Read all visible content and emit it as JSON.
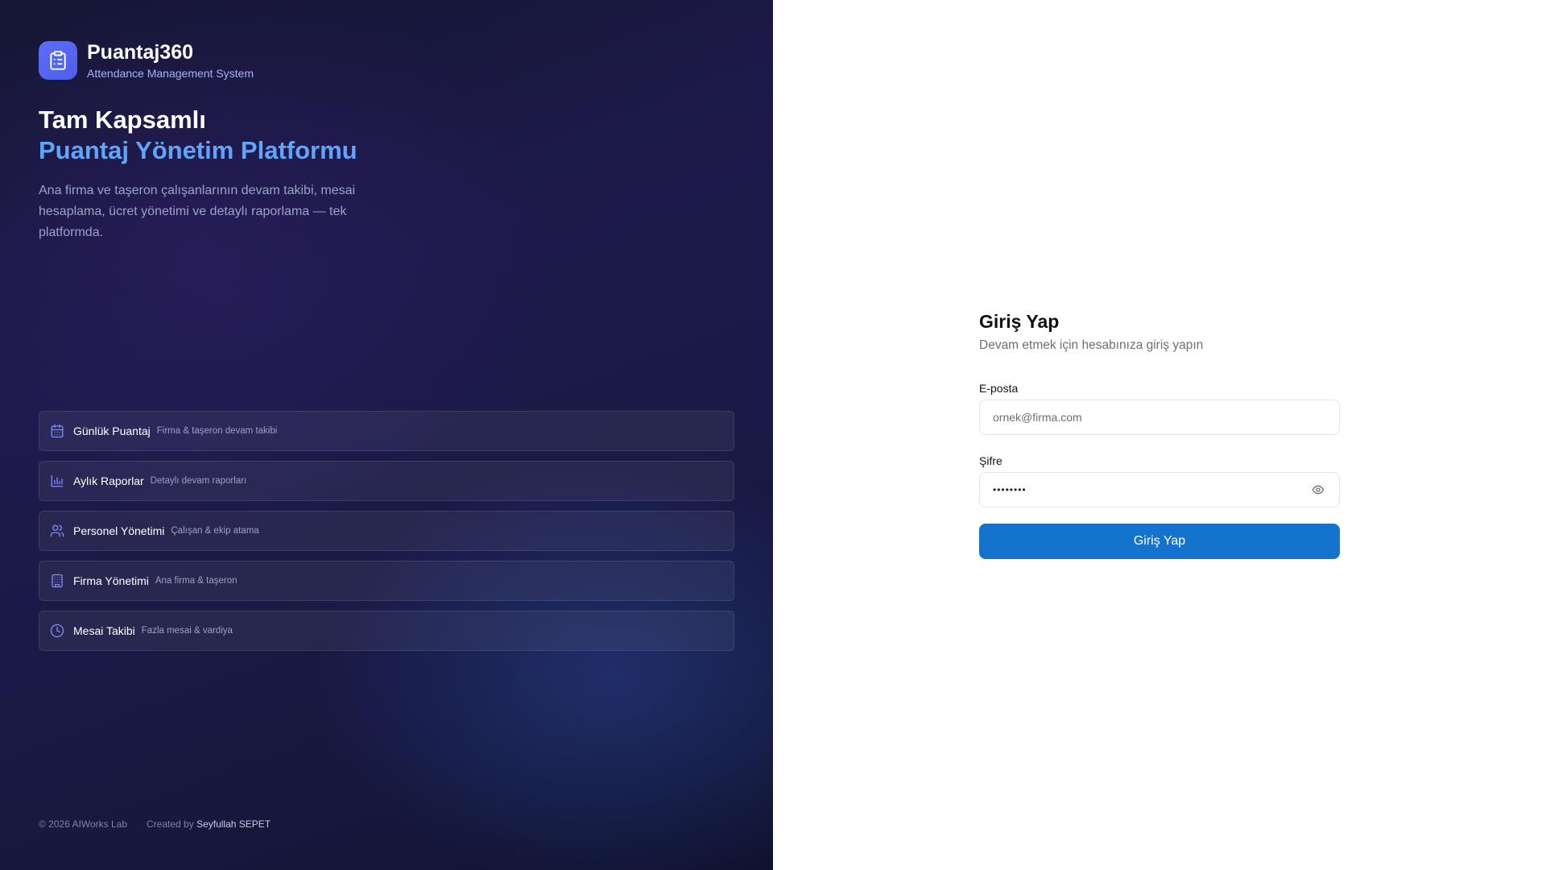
{
  "brand": {
    "name": "Puantaj360",
    "subtitle": "Attendance Management System",
    "icon": "clipboard-list-icon"
  },
  "hero": {
    "line1": "Tam Kapsamlı",
    "line2": "Puantaj Yönetim Platformu",
    "description": "Ana firma ve taşeron çalışanlarının devam takibi, mesai hesaplama, ücret yönetimi ve detaylı raporlama — tek platformda."
  },
  "features": [
    {
      "icon": "calendar-icon",
      "title": "Günlük Puantaj",
      "desc": "Firma & taşeron devam takibi"
    },
    {
      "icon": "bar-chart-icon",
      "title": "Aylık Raporlar",
      "desc": "Detaylı devam raporları"
    },
    {
      "icon": "users-icon",
      "title": "Personel Yönetimi",
      "desc": "Çalışan & ekip atama"
    },
    {
      "icon": "building-icon",
      "title": "Firma Yönetimi",
      "desc": "Ana firma & taşeron"
    },
    {
      "icon": "clock-icon",
      "title": "Mesai Takibi",
      "desc": "Fazla mesai & vardiya"
    }
  ],
  "footer": {
    "copyright": "© 2026 AIWorks Lab",
    "created_by": "Created by",
    "author": "Seyfullah SEPET"
  },
  "login": {
    "title": "Giriş Yap",
    "subtitle": "Devam etmek için hesabınıza giriş yapın",
    "email_label": "E-posta",
    "email_placeholder": "ornek@firma.com",
    "password_label": "Şifre",
    "password_value": "••••••••",
    "submit_label": "Giriş Yap"
  },
  "colors": {
    "accent": "#1473cc",
    "brand_icon_bg": "#5b6cf6",
    "hero_highlight": "#60a5fa",
    "feature_icon": "#818cf8"
  }
}
